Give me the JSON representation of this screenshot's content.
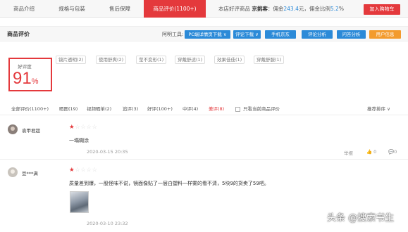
{
  "tabs": [
    {
      "label": "商品介绍"
    },
    {
      "label": "规格与包装"
    },
    {
      "label": "售后保障"
    },
    {
      "label": "商品评价(1100+)"
    }
  ],
  "promo": {
    "prefix": "本店好评商品",
    "brand": "京挑客",
    "commission_label": "：佣金",
    "commission_value": "243.4",
    "unit": "元，",
    "rate_label": "佣金比例",
    "rate_value": "5.2",
    "percent": "%"
  },
  "cart_button": "加入购物车",
  "section": {
    "title": "商品评价",
    "tools_label": "阿明工具:",
    "tools": [
      {
        "label": "PC端详情页下载 ∨",
        "color": "#2b8ad8"
      },
      {
        "label": "评论下载 ∨",
        "color": "#2b8ad8"
      },
      {
        "label": "手机京东",
        "color": "#2b8ad8"
      },
      {
        "label": "评论分析",
        "color": "#2b8ad8"
      },
      {
        "label": "问答分析",
        "color": "#2b8ad8"
      },
      {
        "label": "用户信息",
        "color": "#f39b2d"
      }
    ]
  },
  "rating": {
    "label": "好评度",
    "value": "91",
    "unit": "%"
  },
  "tags": [
    "镜片透明(2)",
    "使用舒爽(2)",
    "莹不变形(1)",
    "穿戴舒适(1)",
    "效果佳佳(1)",
    "穿戴舒服(1)"
  ],
  "filters": {
    "items": [
      {
        "label": "全部评价(1100+)",
        "active": false
      },
      {
        "label": "晒图(19)",
        "active": false
      },
      {
        "label": "视频晒单(2)",
        "active": false
      },
      {
        "label": "追评(3)",
        "active": false
      },
      {
        "label": "好评(100+)",
        "active": false
      },
      {
        "label": "中评(4)",
        "active": false
      },
      {
        "label": "差评(8)",
        "active": true
      }
    ],
    "only_current": "只看当前商品评价",
    "sort": "推荐排序 ∨"
  },
  "reviews": [
    {
      "user": "袁甲君超",
      "stars": 1,
      "content": "一塌糊涂",
      "date": "2020-03-15 20:35",
      "report": "举报",
      "likes": "0",
      "comments": "0"
    },
    {
      "user": "豆***满",
      "stars": 1,
      "content": "质量差到爆，一股怪味不说，镜面像贴了一层白塑料一样雾的看不清，5块9的货卖了59吧。",
      "date": "2020-03-10 23:32"
    }
  ],
  "watermark": "头条 @搜索书生",
  "colors": {
    "brand_red": "#e4393c",
    "tool_blue": "#2b8ad8",
    "tool_orange": "#f39b2d"
  }
}
